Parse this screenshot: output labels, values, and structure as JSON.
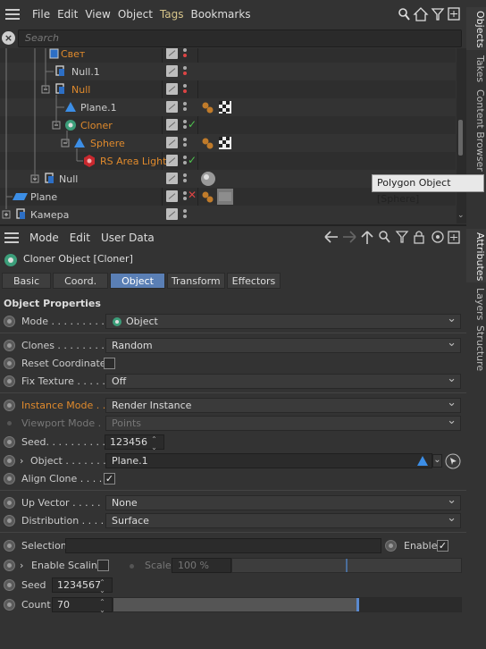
{
  "menu": {
    "items": [
      "File",
      "Edit",
      "View",
      "Object",
      "Tags",
      "Bookmarks"
    ]
  },
  "search": {
    "placeholder": "Search"
  },
  "right_tabs_top": [
    "Objects",
    "Takes",
    "Content Browser"
  ],
  "right_tabs_bottom": [
    "Attributes",
    "Layers",
    "Structure"
  ],
  "tree": {
    "rows": [
      {
        "label": "Свет",
        "color": "#e08a2c"
      },
      {
        "label": "Null.1",
        "color": "#cccccc"
      },
      {
        "label": "Null",
        "color": "#e08a2c"
      },
      {
        "label": "Plane.1",
        "color": "#cccccc"
      },
      {
        "label": "Cloner",
        "color": "#e08a2c"
      },
      {
        "label": "Sphere",
        "color": "#e08a2c"
      },
      {
        "label": "RS Area Light",
        "color": "#e08a2c"
      },
      {
        "label": "Null",
        "color": "#cccccc"
      },
      {
        "label": "Plane",
        "color": "#cccccc"
      },
      {
        "label": "Камера",
        "color": "#cccccc"
      }
    ]
  },
  "tooltip": "Polygon Object [Sphere]",
  "attr_menu": {
    "items": [
      "Mode",
      "Edit",
      "User Data"
    ]
  },
  "object_title": "Cloner Object [Cloner]",
  "tabs": [
    "Basic",
    "Coord.",
    "Object",
    "Transform",
    "Effectors"
  ],
  "section_title": "Object Properties",
  "props": {
    "mode_label": "Mode . . . . . . . . .",
    "mode_value": "Object",
    "clones_label": "Clones . . . . . . . .",
    "clones_value": "Random",
    "reset_label": "Reset Coordinates",
    "fix_label": "Fix Texture . . . . .",
    "fix_value": "Off",
    "instance_label": "Instance Mode . .",
    "instance_value": "Render Instance",
    "viewport_label": "Viewport Mode .",
    "viewport_value": "Points",
    "seed_label": "Seed. . . . . . . . . .",
    "seed_value": "123456",
    "object_label": "Object . . . . . . .",
    "object_value": "Plane.1",
    "align_label": "Align Clone . . . . .",
    "upvector_label": "Up Vector . . . . .",
    "upvector_value": "None",
    "distribution_label": "Distribution . . . .",
    "distribution_value": "Surface",
    "selection_label": "Selection",
    "enable_label": "Enable",
    "enable_scaling_label": "Enable Scaling",
    "scale_label": "Scale",
    "scale_value": "100 %",
    "seed2_label": "Seed",
    "seed2_value": "1234567",
    "count_label": "Count",
    "count_value": "70"
  }
}
